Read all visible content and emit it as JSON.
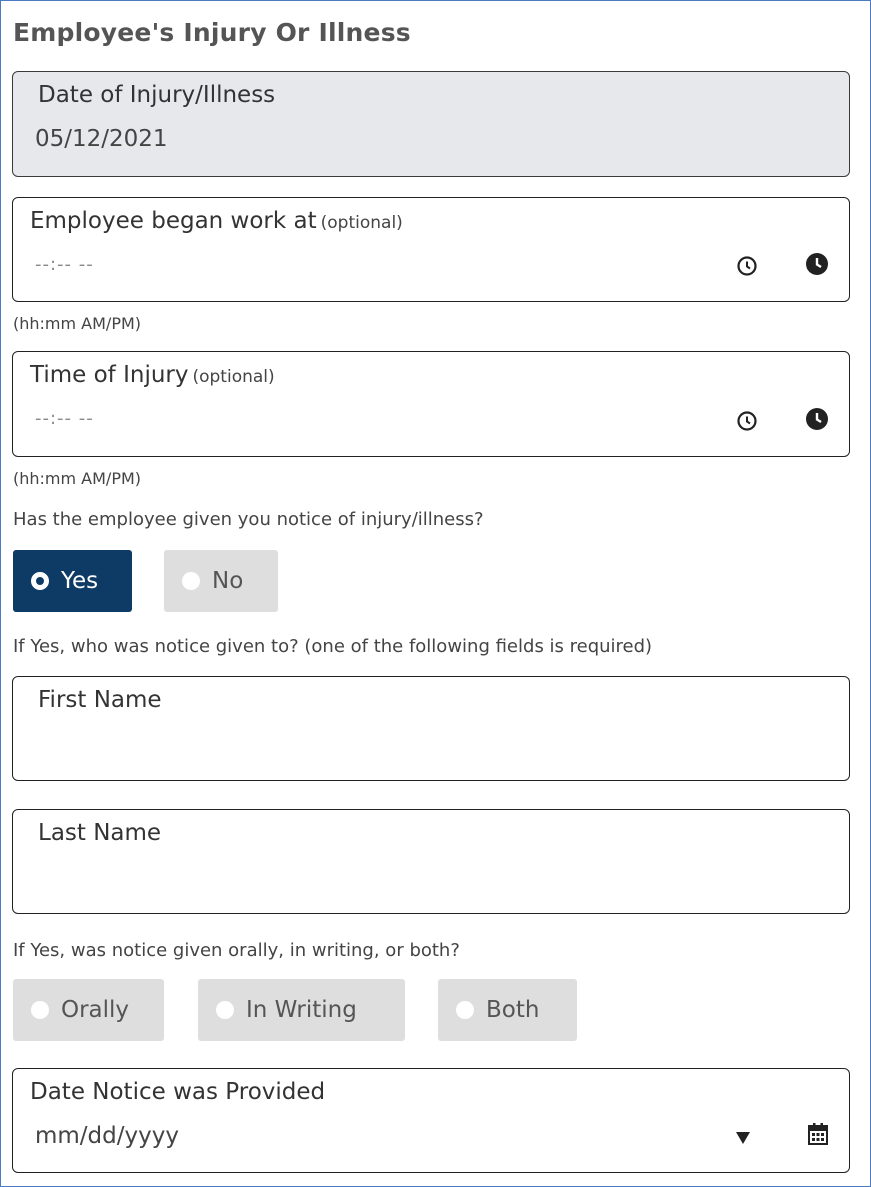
{
  "section": {
    "title": "Employee's Injury Or Illness"
  },
  "date_of_injury": {
    "label": "Date of Injury/Illness",
    "value": "05/12/2021"
  },
  "began_work": {
    "label": "Employee began work at",
    "optional": "(optional)",
    "value": "--:-- --",
    "hint": "(hh:mm AM/PM)",
    "icons": [
      "clock-outline-icon",
      "clock-filled-icon"
    ]
  },
  "time_of_injury": {
    "label": "Time of Injury",
    "optional": "(optional)",
    "value": "--:-- --",
    "hint": "(hh:mm AM/PM)",
    "icons": [
      "clock-outline-icon",
      "clock-filled-icon"
    ]
  },
  "notice_question": {
    "text": "Has the employee given you notice of injury/illness?",
    "options": [
      {
        "label": "Yes",
        "selected": true
      },
      {
        "label": "No",
        "selected": false
      }
    ]
  },
  "notice_to": {
    "text": "If Yes, who was notice given to? (one of the following fields is required)",
    "first_name_label": "First Name",
    "first_name_value": "",
    "last_name_label": "Last Name",
    "last_name_value": ""
  },
  "notice_type": {
    "text": "If Yes, was notice given orally, in writing, or both?",
    "options": [
      {
        "label": "Orally",
        "selected": false
      },
      {
        "label": "In Writing",
        "selected": false
      },
      {
        "label": "Both",
        "selected": false
      }
    ]
  },
  "date_notice": {
    "label": "Date Notice was Provided",
    "placeholder": "mm/dd/yyyy",
    "icons": [
      "dropdown-arrow-icon",
      "calendar-icon"
    ]
  },
  "colors": {
    "selected_radio": "#0d3b66",
    "unselected_radio": "#dedede",
    "readonly_field": "#e6e8eb",
    "frame_border": "#4a7ac2"
  }
}
